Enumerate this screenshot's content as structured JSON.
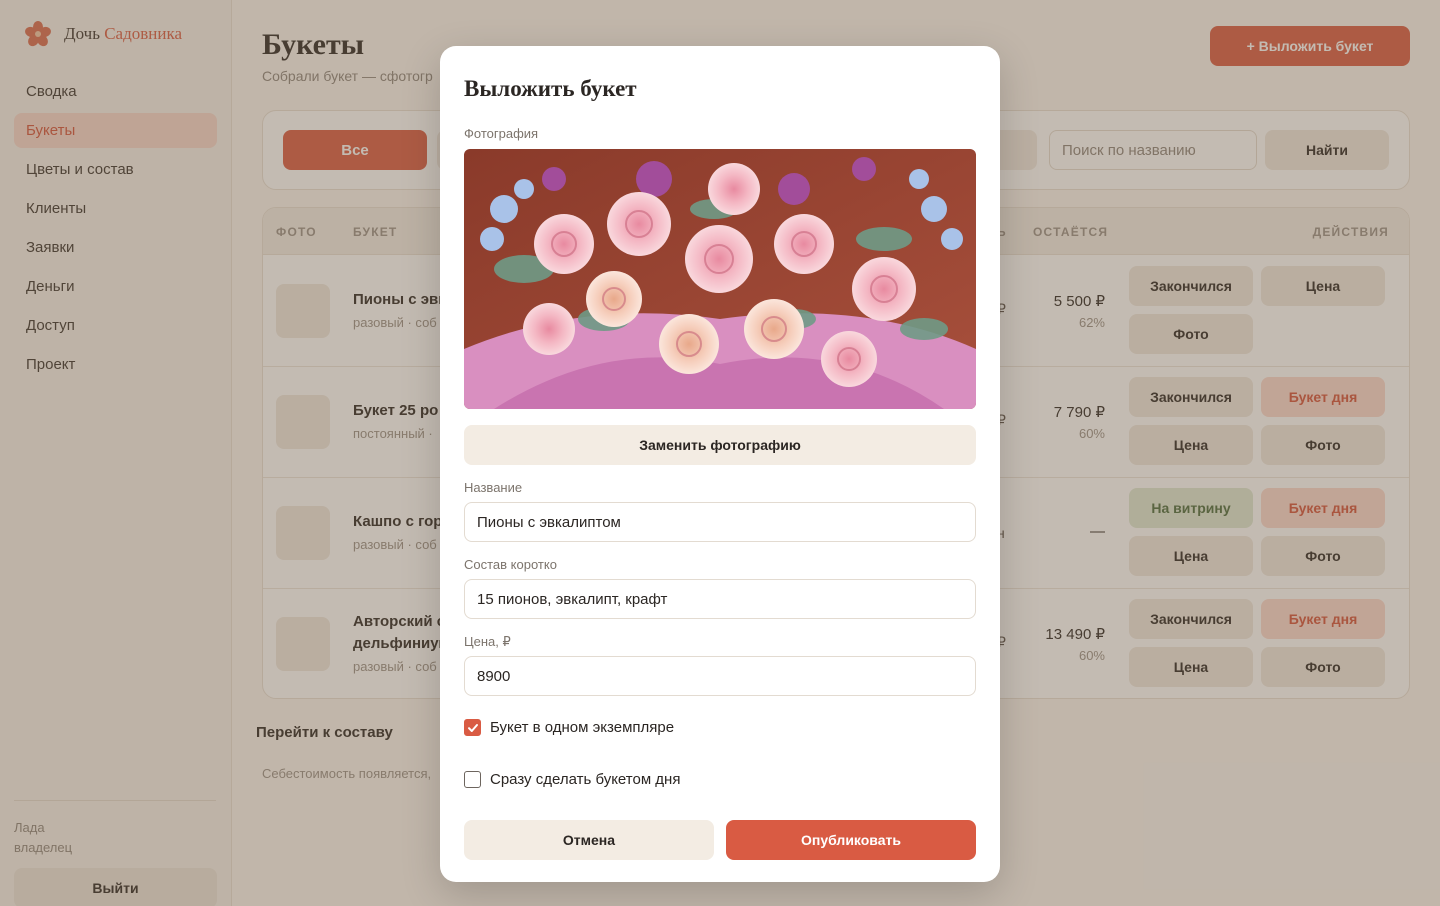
{
  "brand": {
    "name_part1": "Дочь",
    "name_part2": "Садовника"
  },
  "sidebar": {
    "items": [
      {
        "label": "Сводка"
      },
      {
        "label": "Букеты",
        "active": true
      },
      {
        "label": "Цветы и состав"
      },
      {
        "label": "Клиенты"
      },
      {
        "label": "Заявки"
      },
      {
        "label": "Деньги"
      },
      {
        "label": "Доступ"
      },
      {
        "label": "Проект"
      }
    ],
    "user_name": "Лада",
    "user_role": "владелец",
    "logout_label": "Выйти"
  },
  "header": {
    "title": "Букеты",
    "subtitle": "Собрали букет — сфотогр",
    "publish_label": "+ Выложить букет"
  },
  "filters": {
    "all_label": "Все",
    "search_placeholder": "Поиск по названию",
    "search_button": "Найти"
  },
  "table": {
    "columns": {
      "photo": "ФОТО",
      "bouquet": "БУКЕТ",
      "partial": "Ь",
      "remains": "ОСТАЁТСЯ",
      "actions": "ДЕЙСТВИЯ"
    },
    "rows": [
      {
        "name": "Пионы с эвк",
        "meta": "разовый · соб",
        "frag": "₽",
        "remains": "5 500 ₽",
        "pct": "62%",
        "btn1": "Закончился",
        "btn2": "Цена",
        "btn3": "Фото"
      },
      {
        "name": "Букет 25 ро",
        "meta": "постоянный ·",
        "frag": "₽",
        "remains": "7 790 ₽",
        "pct": "60%",
        "btn1": "Закончился",
        "btn2": "Букет дня",
        "btn3": "Цена",
        "btn4": "Фото"
      },
      {
        "name": "Кашпо с гор",
        "meta": "разовый · соб",
        "frag": "н",
        "remains": "—",
        "pct": "",
        "btn1": "На витрину",
        "btn2": "Букет дня",
        "btn3": "Цена",
        "btn4": "Фото"
      },
      {
        "name_line1": "Авторский с",
        "name_line2": "дельфиниум",
        "meta": "разовый · соб",
        "frag": "₽",
        "remains": "13 490 ₽",
        "pct": "60%",
        "btn1": "Закончился",
        "btn2": "Букет дня",
        "btn3": "Цена",
        "btn4": "Фото"
      }
    ]
  },
  "footer": {
    "goto_composition": "Перейти к составу",
    "cost_note": "Себестоимость появляется,"
  },
  "modal": {
    "title": "Выложить букет",
    "photo_label": "Фотография",
    "replace_photo": "Заменить фотографию",
    "name_label": "Название",
    "name_value": "Пионы с эвкалиптом",
    "composition_label": "Состав коротко",
    "composition_value": "15 пионов, эвкалипт, крафт",
    "price_label": "Цена, ₽",
    "price_value": "8900",
    "single_copy_label": "Букет в одном экземпляре",
    "single_copy_checked": true,
    "bouquet_of_day_label": "Сразу сделать букетом дня",
    "bouquet_of_day_checked": false,
    "cancel_label": "Отмена",
    "submit_label": "Опубликовать"
  },
  "colors": {
    "accent": "#d95b43",
    "accent_soft": "#fbd9cf",
    "green_soft": "#dfe8d5",
    "overlay": "#6f5c48"
  }
}
